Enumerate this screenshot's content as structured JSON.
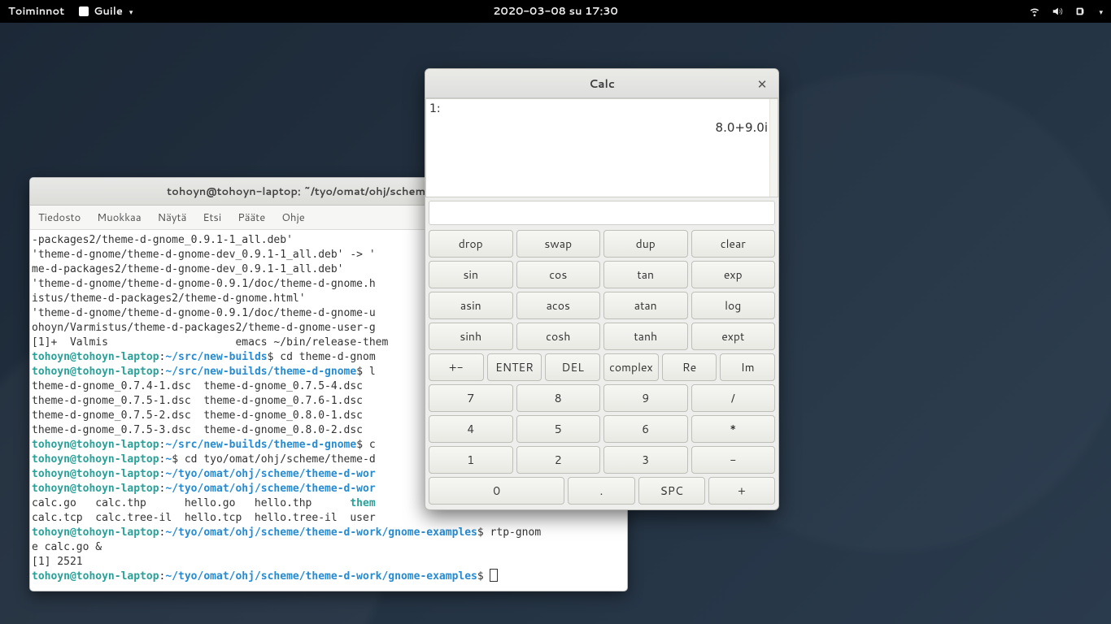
{
  "topbar": {
    "activities": "Toiminnot",
    "app_name": "Guile",
    "datetime": "2020-03-08 su 17:30"
  },
  "terminal": {
    "title": "tohoyn@tohoyn-laptop: ~/tyo/omat/ohj/scheme/theme-d-",
    "menu": {
      "file": "Tiedosto",
      "edit": "Muokkaa",
      "view": "Näytä",
      "search": "Etsi",
      "terminal": "Pääte",
      "help": "Ohje"
    },
    "lines": {
      "l0": "-packages2/theme-d-gnome_0.9.1-1_all.deb'",
      "l1": "'theme-d-gnome/theme-d-gnome-dev_0.9.1-1_all.deb' -> '",
      "l2": "me-d-packages2/theme-d-gnome-dev_0.9.1-1_all.deb'",
      "l3": "'theme-d-gnome/theme-d-gnome-0.9.1/doc/theme-d-gnome.h",
      "l4": "istus/theme-d-packages2/theme-d-gnome.html'",
      "l5": "'theme-d-gnome/theme-d-gnome-0.9.1/doc/theme-d-gnome-u",
      "l6": "ohoyn/Varmistus/theme-d-packages2/theme-d-gnome-user-g",
      "l7a": "[1]+  Valmis                    emacs ~/bin/release-them",
      "p1_user": "tohoyn@tohoyn-laptop",
      "p1_path": "~/src/new-builds",
      "p1_cmd": "$ cd theme-d-gnom",
      "p2_user": "tohoyn@tohoyn-laptop",
      "p2_path": "~/src/new-builds/theme-d-gnome",
      "p2_cmd": "$ l",
      "ls1": "theme-d-gnome_0.7.4-1.dsc  theme-d-gnome_0.7.5-4.dsc  ",
      "ls2": "theme-d-gnome_0.7.5-1.dsc  theme-d-gnome_0.7.6-1.dsc  ",
      "ls3": "theme-d-gnome_0.7.5-2.dsc  theme-d-gnome_0.8.0-1.dsc  ",
      "ls4": "theme-d-gnome_0.7.5-3.dsc  theme-d-gnome_0.8.0-2.dsc  ",
      "p3_user": "tohoyn@tohoyn-laptop",
      "p3_path": "~/src/new-builds/theme-d-gnome",
      "p3_cmd": "$ c",
      "p4_user": "tohoyn@tohoyn-laptop",
      "p4_path": "~",
      "p4_cmd": "$ cd tyo/omat/ohj/scheme/theme-d",
      "p5_user": "tohoyn@tohoyn-laptop",
      "p5_path": "~/tyo/omat/ohj/scheme/theme-d-wor",
      "p6_user": "tohoyn@tohoyn-laptop",
      "p6_path": "~/tyo/omat/ohj/scheme/theme-d-wor",
      "ls5a": "calc.go   calc.thp      hello.go   hello.thp      ",
      "ls5b": "them",
      "ls6": "calc.tcp  calc.tree-il  hello.tcp  hello.tree-il  user",
      "p7_user": "tohoyn@tohoyn-laptop",
      "p7_path": "~/tyo/omat/ohj/scheme/theme-d-work/gnome-examples",
      "p7_cmd": "$ rtp-gnom",
      "ls7": "e calc.go &",
      "ls8": "[1] 2521",
      "p8_user": "tohoyn@tohoyn-laptop",
      "p8_path": "~/tyo/omat/ohj/scheme/theme-d-work/gnome-examples",
      "p8_cmd": "$ "
    }
  },
  "calc": {
    "title": "Calc",
    "stack_label": "1:",
    "stack_value": "8.0+9.0i",
    "buttons": {
      "r0": [
        "drop",
        "swap",
        "dup",
        "clear"
      ],
      "r1": [
        "sin",
        "cos",
        "tan",
        "exp"
      ],
      "r2": [
        "asin",
        "acos",
        "atan",
        "log"
      ],
      "r3": [
        "sinh",
        "cosh",
        "tanh",
        "expt"
      ],
      "r4": [
        "+-",
        "ENTER",
        "DEL",
        "complex",
        "Re",
        "Im"
      ],
      "r5": [
        "7",
        "8",
        "9",
        "/"
      ],
      "r6": [
        "4",
        "5",
        "6",
        "*"
      ],
      "r7": [
        "1",
        "2",
        "3",
        "-"
      ],
      "r8": [
        "0",
        ".",
        "SPC",
        "+"
      ]
    }
  }
}
